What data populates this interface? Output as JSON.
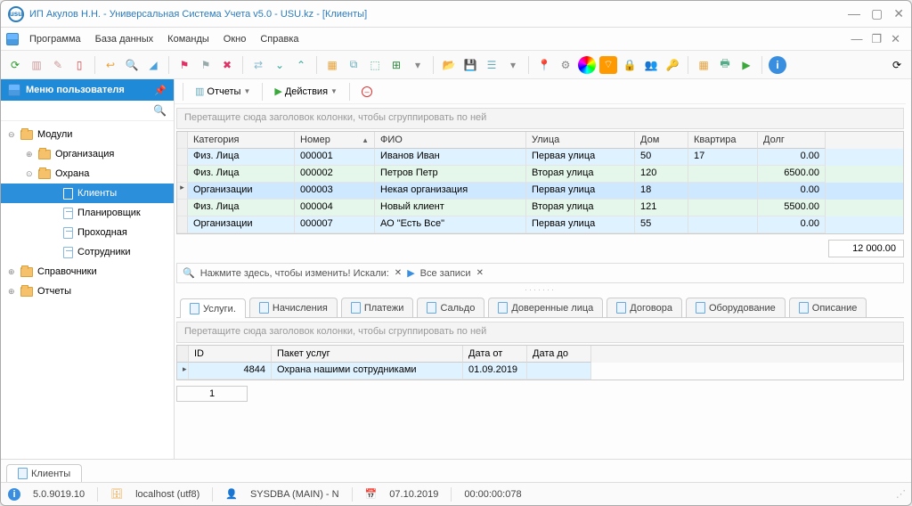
{
  "window": {
    "title": "ИП Акулов Н.Н. - Универсальная Система Учета v5.0 - USU.kz - [Клиенты]",
    "appicon_text": "usu"
  },
  "menubar": {
    "items": [
      "Программа",
      "База данных",
      "Команды",
      "Окно",
      "Справка"
    ]
  },
  "sidebar": {
    "title": "Меню пользователя",
    "tree": [
      {
        "label": "Модули",
        "depth": 0,
        "expander": "⊖",
        "icon": "folder"
      },
      {
        "label": "Организация",
        "depth": 1,
        "expander": "⊕",
        "icon": "folder"
      },
      {
        "label": "Охрана",
        "depth": 1,
        "expander": "⊙",
        "icon": "folder"
      },
      {
        "label": "Клиенты",
        "depth": 2,
        "expander": "",
        "icon": "page",
        "selected": true
      },
      {
        "label": "Планировщик",
        "depth": 2,
        "expander": "",
        "icon": "page"
      },
      {
        "label": "Проходная",
        "depth": 2,
        "expander": "",
        "icon": "page"
      },
      {
        "label": "Сотрудники",
        "depth": 2,
        "expander": "",
        "icon": "page"
      },
      {
        "label": "Справочники",
        "depth": 0,
        "expander": "⊕",
        "icon": "folder"
      },
      {
        "label": "Отчеты",
        "depth": 0,
        "expander": "⊕",
        "icon": "folder"
      }
    ]
  },
  "maintoolbar": {
    "reports_label": "Отчеты",
    "actions_label": "Действия"
  },
  "group_hint": "Перетащите сюда заголовок колонки, чтобы сгруппировать по ней",
  "grid": {
    "columns": [
      "Категория",
      "Номер",
      "ФИО",
      "Улица",
      "Дом",
      "Квартира",
      "Долг"
    ],
    "rows": [
      {
        "mark": "",
        "cls": "row-blue",
        "category": "Физ. Лица",
        "num": "000001",
        "fio": "Иванов Иван",
        "street": "Первая улица",
        "house": "50",
        "flat": "17",
        "debt": "0.00"
      },
      {
        "mark": "",
        "cls": "row-green",
        "category": "Физ. Лица",
        "num": "000002",
        "fio": "Петров Петр",
        "street": "Вторая улица",
        "house": "120",
        "flat": "",
        "debt": "6500.00"
      },
      {
        "mark": "▸",
        "cls": "row-sel",
        "category": "Организации",
        "num": "000003",
        "fio": "Некая организация",
        "street": "Первая улица",
        "house": "18",
        "flat": "",
        "debt": "0.00"
      },
      {
        "mark": "",
        "cls": "row-green",
        "category": "Физ. Лица",
        "num": "000004",
        "fio": "Новый клиент",
        "street": "Вторая улица",
        "house": "121",
        "flat": "",
        "debt": "5500.00"
      },
      {
        "mark": "",
        "cls": "row-blue",
        "category": "Организации",
        "num": "000007",
        "fio": "АО \"Есть Все\"",
        "street": "Первая улица",
        "house": "55",
        "flat": "",
        "debt": "0.00"
      }
    ],
    "total": "12 000.00"
  },
  "filterbar": {
    "search_hint": "Нажмите здесь, чтобы изменить! Искали:",
    "all_records": "Все записи"
  },
  "tabs": {
    "items": [
      "Услуги.",
      "Начисления",
      "Платежи",
      "Сальдо",
      "Доверенные лица",
      "Договора",
      "Оборудование",
      "Описание"
    ],
    "active": 0
  },
  "subgrid": {
    "columns": [
      "ID",
      "Пакет услуг",
      "Дата от",
      "Дата до"
    ],
    "rows": [
      {
        "id": "4844",
        "pack": "Охрана нашими сотрудниками",
        "d1": "01.09.2019",
        "d2": ""
      }
    ],
    "page": "1"
  },
  "bottom_tab": "Клиенты",
  "status": {
    "version": "5.0.9019.10",
    "host": "localhost (utf8)",
    "user": "SYSDBA (MAIN) - N",
    "date": "07.10.2019",
    "time": "00:00:00:078"
  }
}
